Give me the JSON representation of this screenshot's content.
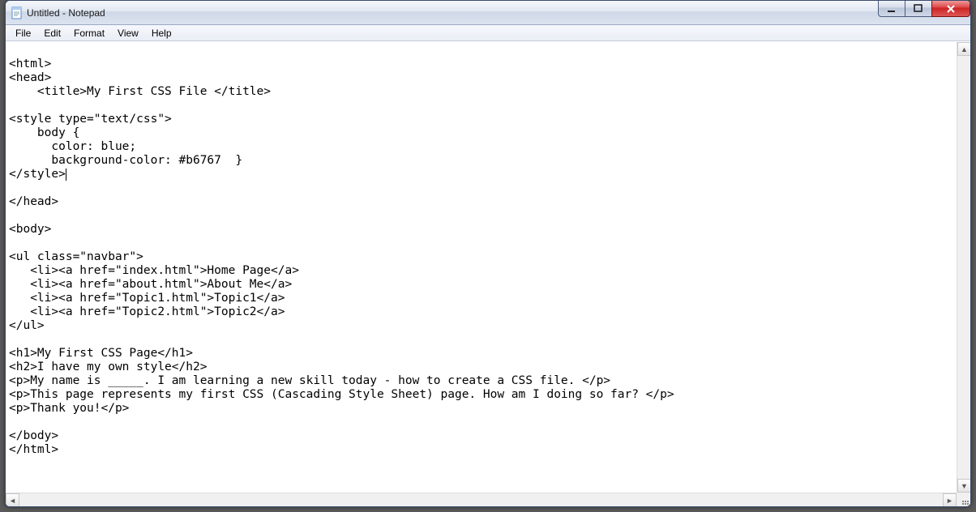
{
  "window": {
    "title": "Untitled - Notepad"
  },
  "menu": {
    "file": "File",
    "edit": "Edit",
    "format": "Format",
    "view": "View",
    "help": "Help"
  },
  "editor": {
    "lines": [
      "",
      "<html>",
      "<head>",
      "    <title>My First CSS File </title>",
      "",
      "<style type=\"text/css\">",
      "    body {",
      "      color: blue;",
      "      background-color: #b6767  }",
      "</style>",
      "",
      "</head>",
      "",
      "<body>",
      "",
      "<ul class=\"navbar\">",
      "   <li><a href=\"index.html\">Home Page</a>",
      "   <li><a href=\"about.html\">About Me</a>",
      "   <li><a href=\"Topic1.html\">Topic1</a>",
      "   <li><a href=\"Topic2.html\">Topic2</a>",
      "</ul>",
      "",
      "<h1>My First CSS Page</h1>",
      "<h2>I have my own style</h2>",
      "<p>My name is _____. I am learning a new skill today - how to create a CSS file. </p>",
      "<p>This page represents my first CSS (Cascading Style Sheet) page. How am I doing so far? </p>",
      "<p>Thank you!</p>",
      "",
      "</body>",
      "</html>"
    ],
    "caret_line": 9,
    "caret_after": "</style>"
  },
  "controls": {
    "minimize": "minimize",
    "maximize": "maximize",
    "close": "close"
  }
}
